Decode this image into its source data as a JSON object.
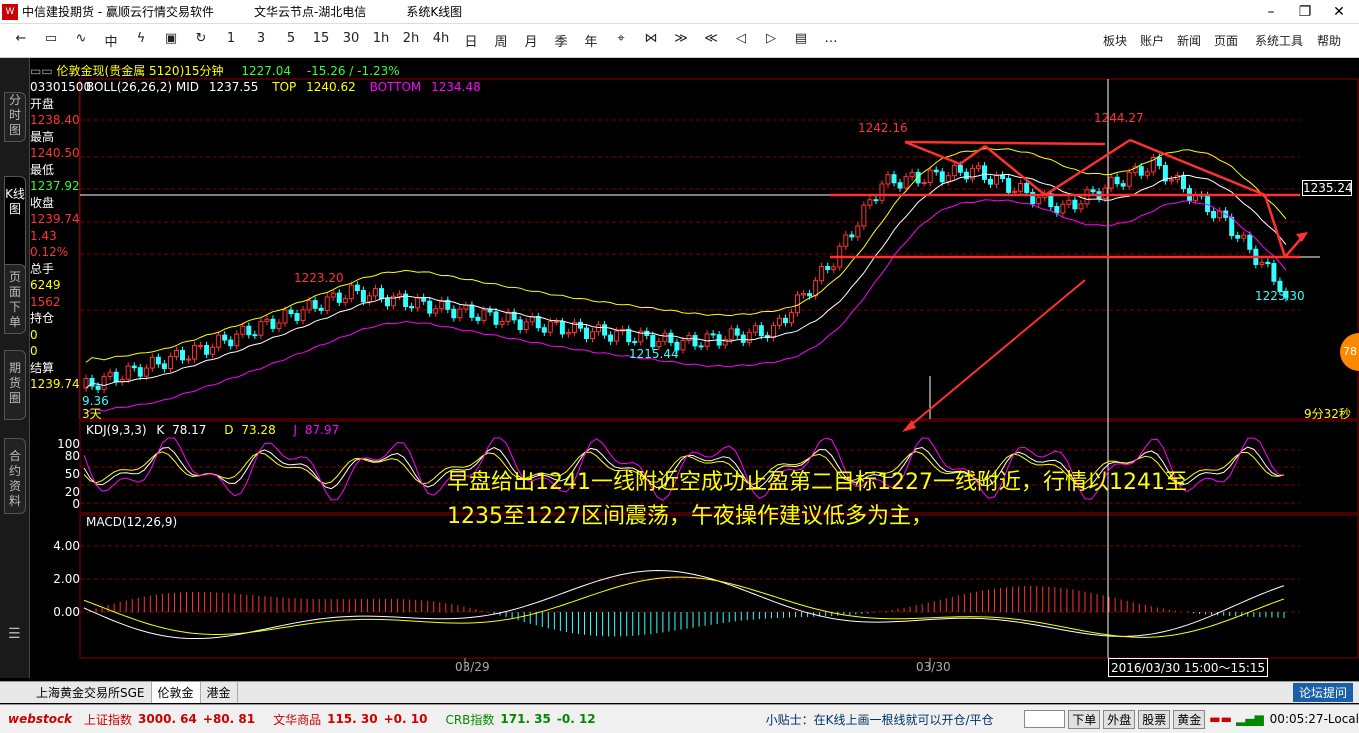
{
  "titlebar": {
    "app_title": "中信建投期货 - 赢顺云行情交易软件",
    "node": "文华云节点-湖北电信",
    "view": "系统K线图"
  },
  "toolbar": {
    "buttons": [
      "←",
      "▭",
      "∿",
      "中",
      "ϟ",
      "▣",
      "↻",
      "1",
      "3",
      "5",
      "15",
      "30",
      "1h",
      "2h",
      "4h",
      "日",
      "周",
      "月",
      "季",
      "年",
      "⌖",
      "⋈",
      "≫",
      "≪",
      "◁",
      "▷",
      "▤",
      "…"
    ],
    "menus": [
      "板块",
      "账户",
      "新闻",
      "页面",
      "系统工具",
      "帮助"
    ]
  },
  "sidebar": {
    "tabs": [
      "分时图",
      "K线图",
      "页面下单",
      "期货圈",
      "合约资料"
    ]
  },
  "chart_header": {
    "instrument": "伦敦金现(贵金属",
    "code": "5120)15分钟",
    "last": "1227.04",
    "change": "-15.26 / -1.23%"
  },
  "boll": {
    "label": "BOLL(26,26,2)",
    "mid_label": "MID",
    "mid": "1237.55",
    "top_label": "TOP",
    "top": "1240.62",
    "bottom_label": "BOTTOM",
    "bottom": "1234.48"
  },
  "info": {
    "date": "03301500",
    "open_label": "开盘",
    "open": "1238.40",
    "high_label": "最高",
    "high": "1240.50",
    "low_label": "最低",
    "low": "1237.92",
    "close_label": "收盘",
    "close": "1239.74",
    "change": "1.43",
    "pct": "0.12%",
    "vol_label": "总手",
    "vol": "6249",
    "vol2": "1562",
    "oi_label": "持仓",
    "oi": "0",
    "oi2": "0",
    "settle_label": "结算",
    "settle": "1239.74"
  },
  "price_labels": {
    "p1223_20": "1223.20",
    "p1215_44": "1215.44",
    "p1242_16": "1242.16",
    "p1244_27": "1244.27",
    "p1223_30": "1223.30",
    "p1235_24": "1235.24",
    "left_low": "9.36",
    "days": "3天",
    "timer": "9分32秒",
    "side_badge": "78"
  },
  "kdj": {
    "label": "KDJ(9,3,3)",
    "k_label": "K",
    "k": "78.17",
    "d_label": "D",
    "d": "73.28",
    "j_label": "J",
    "j": "87.97",
    "axis": [
      "100",
      "80",
      "50",
      "20",
      "0"
    ]
  },
  "macd": {
    "label": "MACD(12,26,9)",
    "axis": [
      "4.00",
      "2.00",
      "0.00"
    ]
  },
  "xaxis": {
    "d1": "03/29",
    "d2": "03/30",
    "cursor": "2016/03/30 15:00～15:15"
  },
  "annotation": {
    "line1": "早盘给出1241一线附近空成功止盈第二目标1227一线附近，行情以1241至",
    "line2": "1235至1227区间震荡，午夜操作建议低多为主，"
  },
  "bottom_tabs": [
    "上海黄金交易所SGE",
    "伦敦金",
    "港金"
  ],
  "forum_button": "论坛提问",
  "status": {
    "brand": "webstock",
    "idx1_name": "上证指数",
    "idx1_val": "3000. 64",
    "idx1_chg": "+80. 81",
    "idx2_name": "文华商品",
    "idx2_val": "115. 30",
    "idx2_chg": "+0. 10",
    "idx3_name": "CRB指数",
    "idx3_val": "171. 35",
    "idx3_chg": "-0. 12",
    "tip": "小贴士：在K线上画一根线就可以开仓/平仓",
    "buttons": [
      "下单",
      "外盘",
      "股票",
      "黄金"
    ],
    "time": "00:05:27-Local"
  },
  "colors": {
    "up": "#ff3333",
    "down": "#33ffff",
    "boll_mid": "#ffffff",
    "boll_top": "#ffff00",
    "boll_bottom": "#ff00ff",
    "drawing": "#ff3030",
    "annotation": "#ffff00"
  }
}
